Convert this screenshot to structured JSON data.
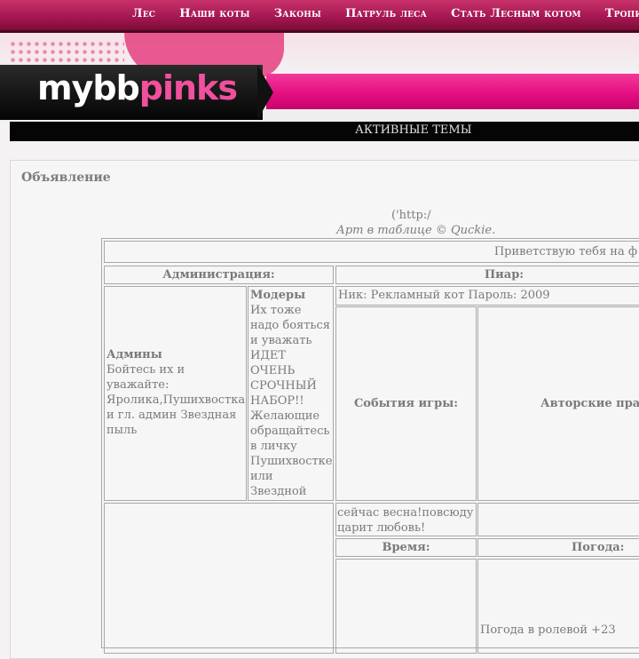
{
  "nav": {
    "items": [
      "Лес",
      "Наши коты",
      "Законы",
      "Патруль леса",
      "Стать Лесным котом",
      "Тропин"
    ]
  },
  "logo": {
    "part1": "mybb",
    "part2": "pinks"
  },
  "active_topics": "АКТИВНЫЕ ТЕМЫ",
  "announcement": {
    "title": "Объявление",
    "http_text": "('http:/",
    "art_credit": "Арт в таблице © Quckie.",
    "welcome": "Приветствую тебя на ф",
    "admin_header": "Администрация:",
    "pr_header": "Пиар:",
    "admins_title": "Админы",
    "admins_text": "Бойтесь их и уважайте: Яролика,Пушихвостка и гл. админ Звездная пыль",
    "mods_title": "Модеры",
    "mods_text": "Их тоже надо бояться и уважать ИДЕТ ОЧЕНЬ СРОЧНЫЙ НАБОР!! Желающие обращайтесь в личку Пушихвостке или Звездной пыли!",
    "pr_login": "Ник: Рекламный кот Пароль: 2009",
    "events_header": "События игры:",
    "copyright_header": "Авторские пра",
    "spring_text": "сейчас весна!повсюду царит любовь!",
    "time_header": "Время:",
    "weather_header": "Погода:",
    "weather_text": "Погода в ролевой +23"
  },
  "colors": {
    "nav": "#a31650",
    "pink": "#e40c7f",
    "black_bar": "#050505"
  }
}
